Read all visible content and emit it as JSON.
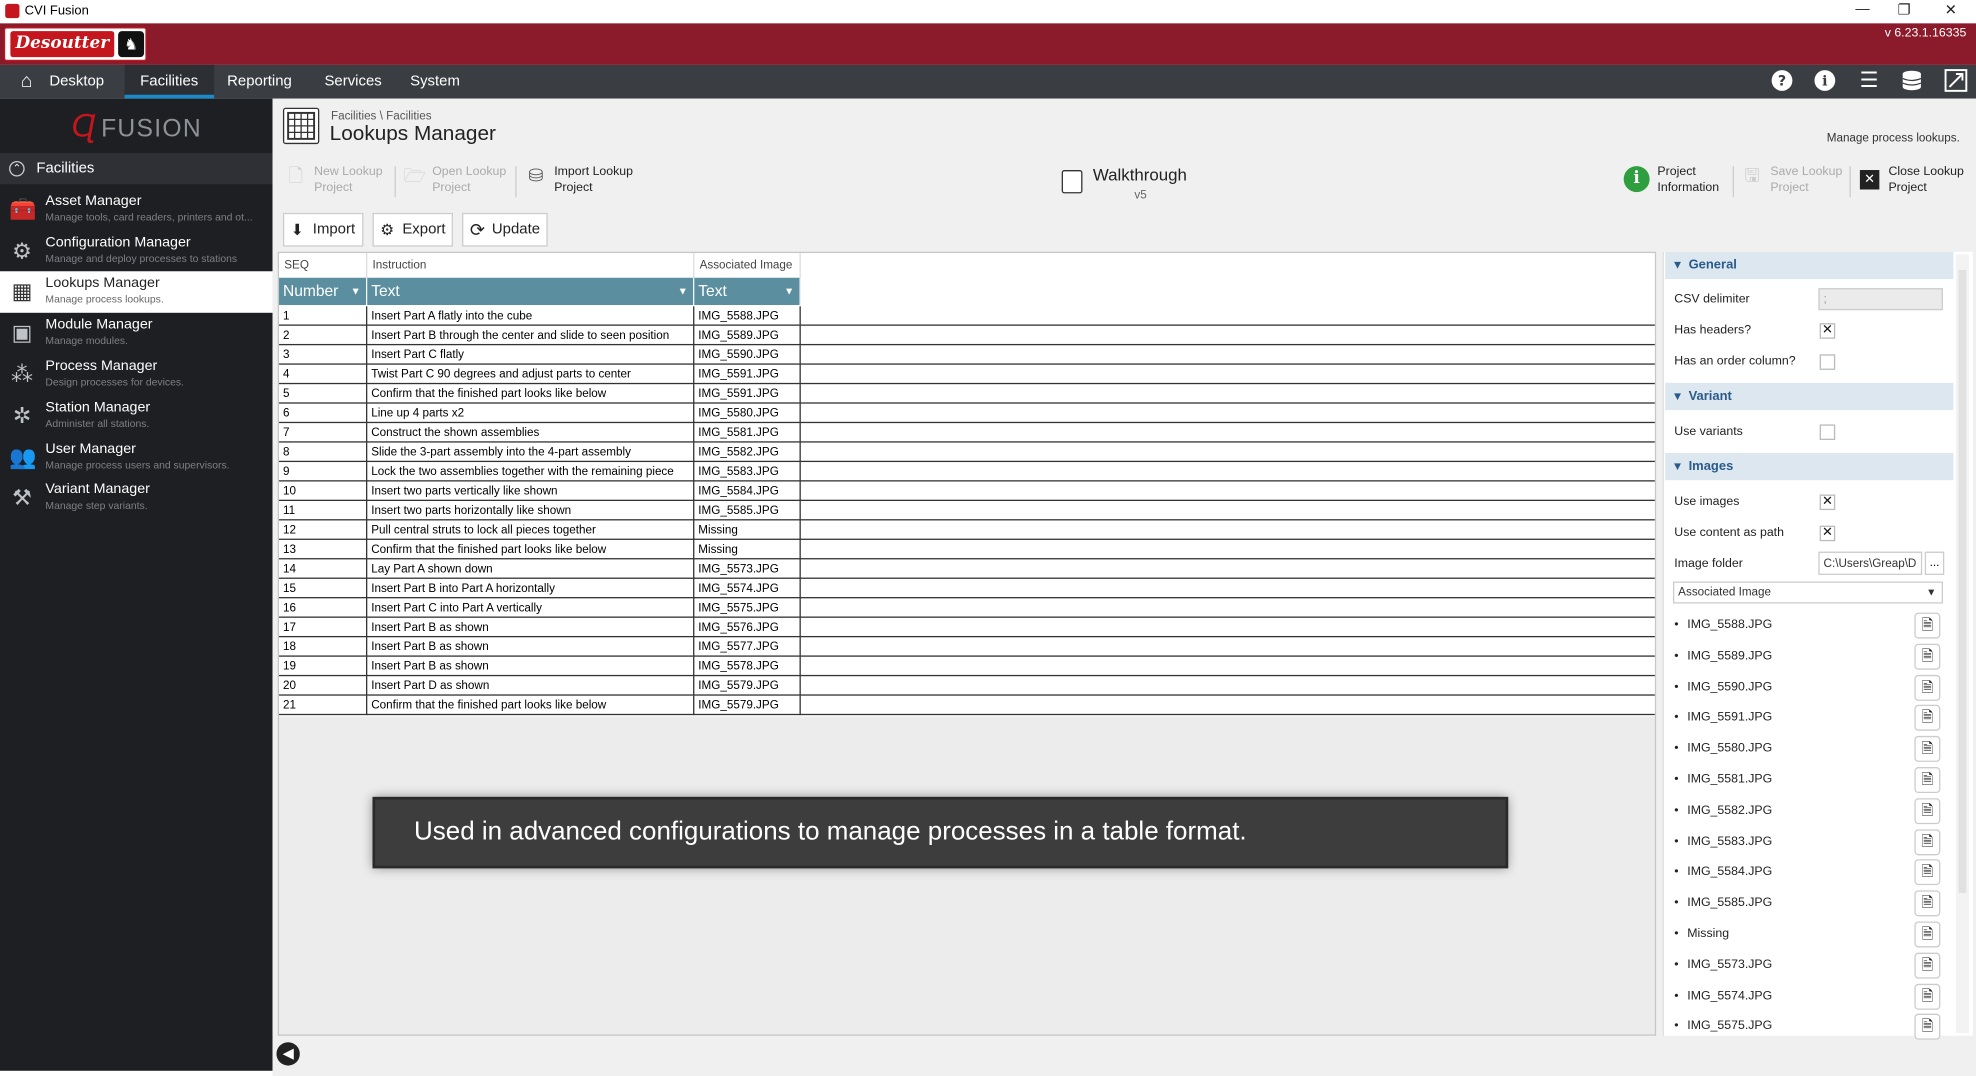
{
  "window": {
    "title": "CVI Fusion",
    "minimize": "—",
    "restore": "❐",
    "close": "✕"
  },
  "brand": {
    "logo_text": "Desoutter",
    "version": "v 6.23.1.16335"
  },
  "menu": {
    "desktop": "Desktop",
    "items": [
      "Facilities",
      "Reporting",
      "Services",
      "System"
    ],
    "active": "Facilities"
  },
  "sidebar": {
    "logo": "FUSION",
    "header": "Facilities",
    "items": [
      {
        "title": "Asset Manager",
        "subtitle": "Manage tools, card readers, printers and ot..."
      },
      {
        "title": "Configuration Manager",
        "subtitle": "Manage and deploy processes to stations"
      },
      {
        "title": "Lookups Manager",
        "subtitle": "Manage process lookups."
      },
      {
        "title": "Module Manager",
        "subtitle": "Manage modules."
      },
      {
        "title": "Process Manager",
        "subtitle": "Design processes for devices."
      },
      {
        "title": "Station Manager",
        "subtitle": "Administer all stations."
      },
      {
        "title": "User Manager",
        "subtitle": "Manage process users and supervisors."
      },
      {
        "title": "Variant Manager",
        "subtitle": "Manage step variants."
      }
    ]
  },
  "page": {
    "breadcrumb": "Facilities \\ Facilities",
    "title": "Lookups Manager",
    "description": "Manage process lookups."
  },
  "toolbar": {
    "new_lookup_1": "New Lookup",
    "new_lookup_2": "Project",
    "open_lookup_1": "Open Lookup",
    "open_lookup_2": "Project",
    "import_lookup_1": "Import Lookup",
    "import_lookup_2": "Project",
    "project_name": "Walkthrough",
    "project_version": "v5",
    "project_info_1": "Project",
    "project_info_2": "Information",
    "save_lookup_1": "Save Lookup",
    "save_lookup_2": "Project",
    "close_lookup_1": "Close Lookup",
    "close_lookup_2": "Project"
  },
  "actions": {
    "import": "Import",
    "export": "Export",
    "update": "Update"
  },
  "table": {
    "group_headers": [
      "SEQ",
      "Instruction",
      "Associated Image"
    ],
    "columns": [
      "Number",
      "Text",
      "Text"
    ],
    "rows": [
      [
        "1",
        "Insert Part A flatly into the cube",
        "IMG_5588.JPG"
      ],
      [
        "2",
        "Insert Part B through the center and slide to seen position",
        "IMG_5589.JPG"
      ],
      [
        "3",
        "Insert Part C flatly",
        "IMG_5590.JPG"
      ],
      [
        "4",
        "Twist Part C 90 degrees and adjust parts to center",
        "IMG_5591.JPG"
      ],
      [
        "5",
        "Confirm that the finished part looks like below",
        "IMG_5591.JPG"
      ],
      [
        "6",
        "Line up 4 parts x2",
        "IMG_5580.JPG"
      ],
      [
        "7",
        "Construct the shown assemblies",
        "IMG_5581.JPG"
      ],
      [
        "8",
        "Slide the 3-part assembly into the 4-part assembly",
        "IMG_5582.JPG"
      ],
      [
        "9",
        "Lock the two assemblies together with the remaining piece",
        "IMG_5583.JPG"
      ],
      [
        "10",
        "Insert two parts vertically like shown",
        "IMG_5584.JPG"
      ],
      [
        "11",
        "Insert two parts horizontally like shown",
        "IMG_5585.JPG"
      ],
      [
        "12",
        "Pull central struts to lock all pieces together",
        "Missing"
      ],
      [
        "13",
        "Confirm that the finished part looks like below",
        "Missing"
      ],
      [
        "14",
        "Lay Part A shown down",
        "IMG_5573.JPG"
      ],
      [
        "15",
        "Insert Part B into Part A horizontally",
        "IMG_5574.JPG"
      ],
      [
        "16",
        "Insert Part C into Part A vertically",
        "IMG_5575.JPG"
      ],
      [
        "17",
        "Insert Part B as shown",
        "IMG_5576.JPG"
      ],
      [
        "18",
        "Insert Part B as shown",
        "IMG_5577.JPG"
      ],
      [
        "19",
        "Insert Part B as shown",
        "IMG_5578.JPG"
      ],
      [
        "20",
        "Insert Part D as shown",
        "IMG_5579.JPG"
      ],
      [
        "21",
        "Confirm that the finished part looks like below",
        "IMG_5579.JPG"
      ]
    ]
  },
  "tooltip": "Used in advanced configurations to manage processes in a table format.",
  "properties": {
    "general": {
      "title": "General",
      "csv_delimiter_label": "CSV delimiter",
      "csv_delimiter_value": ";",
      "has_headers_label": "Has headers?",
      "has_order_label": "Has an order column?"
    },
    "variant": {
      "title": "Variant",
      "use_variants_label": "Use variants"
    },
    "images": {
      "title": "Images",
      "use_images_label": "Use images",
      "use_content_label": "Use content as path",
      "folder_label": "Image folder",
      "folder_value": "C:\\Users\\Greap\\D",
      "browse": "...",
      "column_select": "Associated Image",
      "list": [
        "IMG_5588.JPG",
        "IMG_5589.JPG",
        "IMG_5590.JPG",
        "IMG_5591.JPG",
        "IMG_5580.JPG",
        "IMG_5581.JPG",
        "IMG_5582.JPG",
        "IMG_5583.JPG",
        "IMG_5584.JPG",
        "IMG_5585.JPG",
        "Missing",
        "IMG_5573.JPG",
        "IMG_5574.JPG",
        "IMG_5575.JPG"
      ]
    },
    "checked_mark": "✕"
  },
  "colors": {
    "brand": "#8b1a2b",
    "accent": "#1b8ac9",
    "column_header": "#5b8fa0",
    "info_green": "#2e9e3e"
  }
}
